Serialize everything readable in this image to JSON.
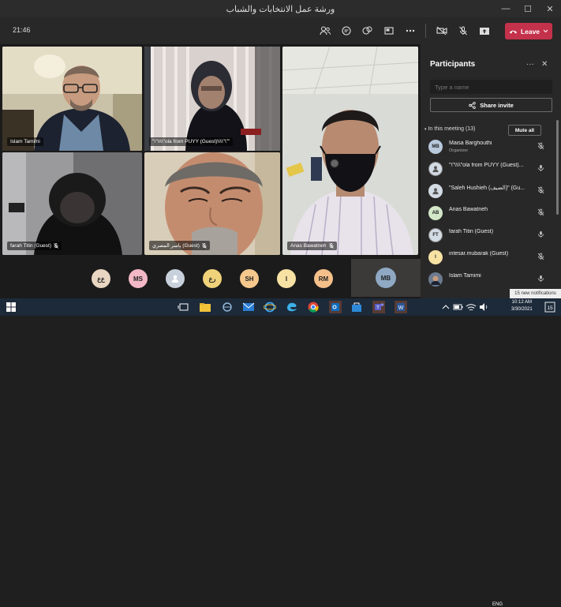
{
  "window": {
    "title": "ورشة عمل الانتخابات والشباب",
    "controls": [
      "—",
      "☐",
      "✕"
    ]
  },
  "toolbar": {
    "timer": "21:46",
    "leave_label": "Leave",
    "leave_color": "#c4314b"
  },
  "tiles": [
    {
      "name": "Islam Tamimi",
      "mic_off": false
    },
    {
      "name": "\"\\\"\\\\\\\\\"ola from PUYY (Guest)\\\\\\\\\"\\\"\"",
      "mic_off": false
    },
    {
      "name": "Anas Bawatneh",
      "mic_off": true
    },
    {
      "name": "farah Titin (Guest)",
      "mic_off": true
    },
    {
      "name": "ياسر المصري (Guest)",
      "mic_off": true
    }
  ],
  "bottom_avatars": [
    {
      "initials": "ع‌ع",
      "color": "#e8d6c2"
    },
    {
      "initials": "MS",
      "color": "#f2b8c6"
    },
    {
      "initials": "",
      "color": "#c8d0dc"
    },
    {
      "initials": "ر‌ع",
      "color": "#f0d27a"
    },
    {
      "initials": "SH",
      "color": "#f6c88d"
    },
    {
      "initials": "I",
      "color": "#f7e2a4"
    },
    {
      "initials": "RM",
      "color": "#f5c089"
    }
  ],
  "me_tile": {
    "initials": "MB"
  },
  "panel": {
    "title": "Participants",
    "search_placeholder": "Type a name",
    "share_label": "Share invite",
    "section_label": "In this meeting (13)",
    "mute_all_label": "Mute all",
    "participants": [
      {
        "initials": "MB",
        "name": "Maisa Barghouthi",
        "role": "Organizer",
        "color": "#b9c9dc",
        "mic": "off"
      },
      {
        "initials": "",
        "name": "\"\\\"\\\\\\\\\"ola from PUYY (Guest)...",
        "role": "",
        "color": "#d3dbe4",
        "mic": "on"
      },
      {
        "initials": "",
        "name": "\"Saleh Hushieh (الضيف)\" (Gu...",
        "role": "",
        "color": "#d3dbe4",
        "mic": "off"
      },
      {
        "initials": "AB",
        "name": "Anas Bawatneh",
        "role": "",
        "color": "#d2e7c8",
        "mic": "off"
      },
      {
        "initials": "FT",
        "name": "farah Titin (Guest)",
        "role": "",
        "color": "#d3dbe4",
        "mic": "on"
      },
      {
        "initials": "I",
        "name": "intesar.mubarak (Guest)",
        "role": "",
        "color": "#f7e2a4",
        "mic": "off"
      },
      {
        "initials": "",
        "name": "Islam Tamimi",
        "role": "",
        "color": "#6b7b90",
        "mic": "on"
      }
    ]
  },
  "taskbar": {
    "notification": "15 new notifications",
    "time": "10:12 AM",
    "date": "3/30/2021",
    "lang": "ENG"
  }
}
